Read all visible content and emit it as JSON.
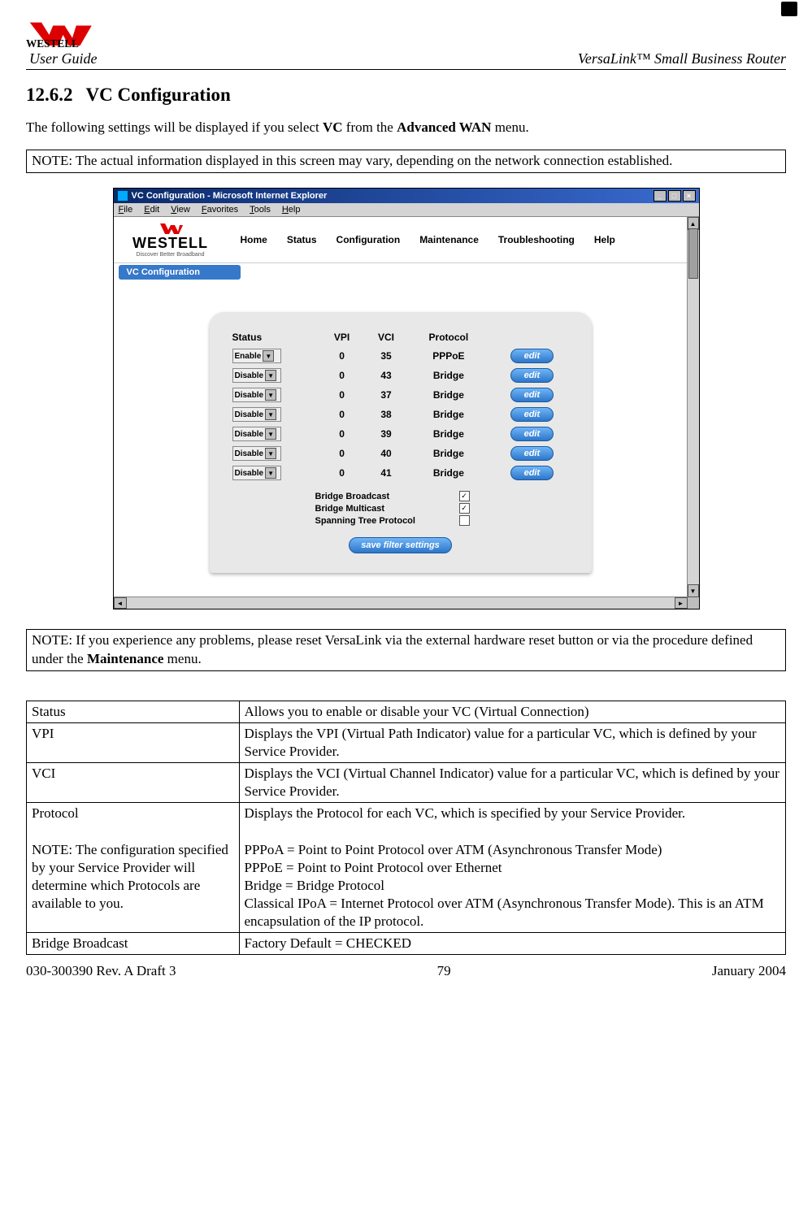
{
  "header": {
    "user_guide": "User Guide",
    "product": "VersaLink™  Small Business Router"
  },
  "section": {
    "number": "12.6.2",
    "title": "VC Configuration"
  },
  "intro_prefix": "The following settings will be displayed if you select ",
  "intro_bold1": "VC",
  "intro_mid": " from the ",
  "intro_bold2": "Advanced WAN",
  "intro_suffix": " menu.",
  "note1": "NOTE: The actual information displayed in this screen may vary, depending on the network connection established.",
  "note2_prefix": "NOTE: If you experience any problems, please reset VersaLink via the external hardware reset button or via the procedure defined under the ",
  "note2_bold": "Maintenance",
  "note2_suffix": " menu.",
  "screenshot": {
    "title": "VC Configuration - Microsoft Internet Explorer",
    "menu": [
      "File",
      "Edit",
      "View",
      "Favorites",
      "Tools",
      "Help"
    ],
    "logo_big": "WESTELL",
    "logo_tag": "Discover Better Broadband",
    "nav": [
      "Home",
      "Status",
      "Configuration",
      "Maintenance",
      "Troubleshooting",
      "Help"
    ],
    "breadcrumb": "VC Configuration",
    "table_head": {
      "status": "Status",
      "vpi": "VPI",
      "vci": "VCI",
      "protocol": "Protocol"
    },
    "rows": [
      {
        "status": "Enable",
        "vpi": "0",
        "vci": "35",
        "protocol": "PPPoE",
        "edit": "edit"
      },
      {
        "status": "Disable",
        "vpi": "0",
        "vci": "43",
        "protocol": "Bridge",
        "edit": "edit"
      },
      {
        "status": "Disable",
        "vpi": "0",
        "vci": "37",
        "protocol": "Bridge",
        "edit": "edit"
      },
      {
        "status": "Disable",
        "vpi": "0",
        "vci": "38",
        "protocol": "Bridge",
        "edit": "edit"
      },
      {
        "status": "Disable",
        "vpi": "0",
        "vci": "39",
        "protocol": "Bridge",
        "edit": "edit"
      },
      {
        "status": "Disable",
        "vpi": "0",
        "vci": "40",
        "protocol": "Bridge",
        "edit": "edit"
      },
      {
        "status": "Disable",
        "vpi": "0",
        "vci": "41",
        "protocol": "Bridge",
        "edit": "edit"
      }
    ],
    "checks": [
      {
        "label": "Bridge Broadcast",
        "checked": true
      },
      {
        "label": "Bridge Multicast",
        "checked": true
      },
      {
        "label": "Spanning Tree Protocol",
        "checked": false
      }
    ],
    "save": "save filter settings"
  },
  "def_table": [
    {
      "term": "Status",
      "desc": "Allows you to enable or disable your VC (Virtual Connection)"
    },
    {
      "term": "VPI",
      "desc": "Displays the VPI (Virtual Path Indicator) value for a particular VC, which is defined by your Service Provider."
    },
    {
      "term": "VCI",
      "desc": "Displays the VCI (Virtual Channel Indicator) value for a particular VC, which is defined by your Service Provider."
    },
    {
      "term": "Protocol\n\nNOTE: The configuration specified by your Service Provider will determine which Protocols are available to you.",
      "desc": "Displays the Protocol for each VC, which is specified by your Service Provider.\n\nPPPoA = Point to Point Protocol over ATM (Asynchronous Transfer Mode)\nPPPoE = Point to Point Protocol over Ethernet\nBridge = Bridge Protocol\nClassical IPoA = Internet Protocol over ATM (Asynchronous Transfer Mode). This is an ATM encapsulation of the IP protocol."
    },
    {
      "term": "Bridge Broadcast",
      "desc": "Factory Default = CHECKED"
    }
  ],
  "footer": {
    "left": "030-300390 Rev. A Draft 3",
    "center": "79",
    "right": "January 2004"
  }
}
